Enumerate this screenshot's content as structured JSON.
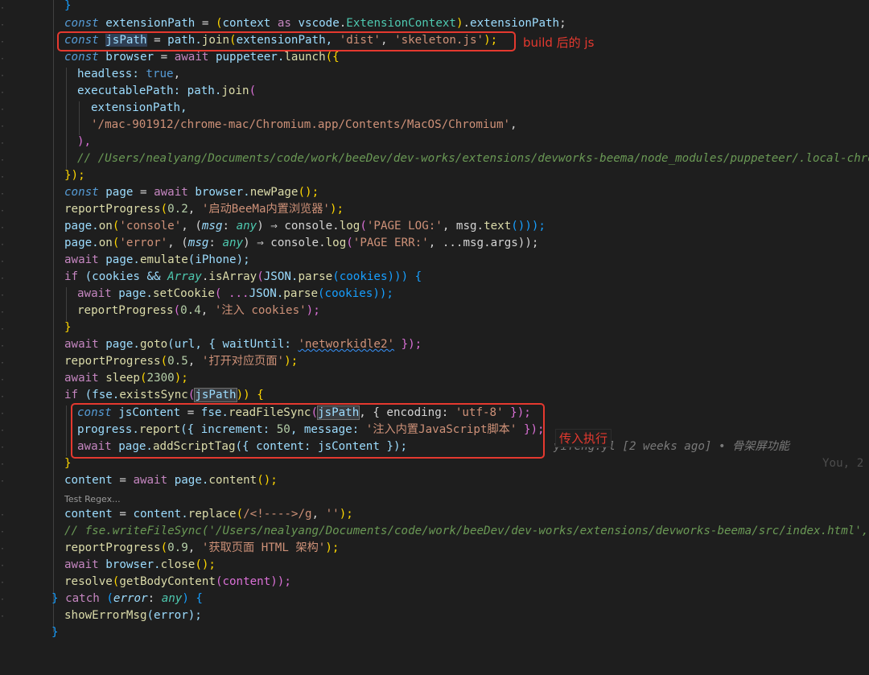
{
  "lines": {
    "close_brace_top": "}",
    "extensionPath_decl": [
      "const",
      "extensionPath",
      "=",
      "(context",
      "as",
      "vscode.ExtensionContext).extensionPath;"
    ],
    "jsPath": {
      "const": "const",
      "name": "jsPath",
      "eq": "=",
      "obj": "path.",
      "fn": "join",
      "open": "(",
      "arg1": "extensionPath, ",
      "s1": "'dist'",
      "comma": ", ",
      "s2": "'skeleton.js'",
      "close": ");"
    },
    "browser": {
      "const": "const",
      "name": "browser",
      "eq": "=",
      "await": "await",
      "obj": "puppeteer.",
      "fn": "launch",
      "open": "({"
    },
    "headless": {
      "key": "headless:",
      "val": "true",
      "comma": ","
    },
    "executablePath": {
      "key": "executablePath:",
      "obj": "path.",
      "fn": "join",
      "open": "("
    },
    "extensionPath_arg": "extensionPath,",
    "chromium_path": "'/mac-901912/chrome-mac/Chromium.app/Contents/MacOS/Chromium'",
    "chromium_comma": ",",
    "close_paren": "),",
    "comment_users": "// /Users/nealyang/Documents/code/work/beeDev/dev-works/extensions/devworks-beema/node_modules/puppeteer/.local-chrom",
    "close_launch": "});",
    "page_decl": {
      "const": "const",
      "name": "page",
      "eq": "=",
      "await": "await",
      "obj": "browser.",
      "fn": "newPage",
      "call": "();"
    },
    "report1": {
      "fn": "reportProgress",
      "open": "(",
      "num": "0.2",
      "comma": ", ",
      "str": "'启动BeeMa内置浏览器'",
      "close": ");"
    },
    "on_console": {
      "obj": "page.",
      "fn": "on",
      "open": "(",
      "str": "'console'",
      "comma": ", (",
      "param": "msg",
      "colon": ":",
      "type": "any",
      "arrow": ") ⇒ console.",
      "fn2": "log",
      "open2": "(",
      "str2": "'PAGE LOG:'",
      "rest": ", msg.",
      "fn3": "text",
      "close": "()));"
    },
    "on_error": {
      "obj": "page.",
      "fn": "on",
      "open": "(",
      "str": "'error'",
      "comma": ", (",
      "param": "msg",
      "colon": ":",
      "type": "any",
      "arrow": ") ⇒ console.",
      "fn2": "log",
      "open2": "(",
      "str2": "'PAGE ERR:'",
      "rest": ", ...msg.args));"
    },
    "emulate": {
      "await": "await",
      "obj": "page.",
      "fn": "emulate",
      "arg": "(iPhone);"
    },
    "if_cookies": {
      "if": "if",
      "open": "(cookies && ",
      "cls": "Array",
      "dot": ".",
      "fn": "isArray",
      "p1": "(",
      "obj": "JSON.",
      "fn2": "parse",
      "p2": "(cookies))) {"
    },
    "setCookie": {
      "await": "await",
      "obj": "page.",
      "fn": "setCookie",
      "rest1": "( ...",
      "obj2": "JSON.",
      "fn2": "parse",
      "rest2": "(cookies));"
    },
    "report2": {
      "fn": "reportProgress",
      "open": "(",
      "num": "0.4",
      "comma": ", ",
      "str": "'注入 cookies'",
      "close": ");"
    },
    "close_if": "}",
    "goto": {
      "await": "await",
      "obj": "page.",
      "fn": "goto",
      "rest": "(url, { waitUntil: ",
      "str": "'networkidle2'",
      "close": " });"
    },
    "report3": {
      "fn": "reportProgress",
      "open": "(",
      "num": "0.5",
      "comma": ", ",
      "str": "'打开对应页面'",
      "close": ");"
    },
    "sleep": {
      "await": "await",
      "fn": "sleep",
      "open": "(",
      "num": "2300",
      "close": ");"
    },
    "if_exists": {
      "if": "if",
      "open": "(fse.",
      "fn": "existsSync",
      "p": "(",
      "name": "jsPath",
      "close": ")) {"
    },
    "jsContent": {
      "const": "const",
      "name": "jsContent",
      "eq": "=",
      "obj": "fse.",
      "fn": "readFileSync",
      "open": "(",
      "arg": "jsPath",
      "rest": ", { encoding: ",
      "str": "'utf-8'",
      "close": " });"
    },
    "progress_report": {
      "obj": "progress.",
      "fn": "report",
      "rest": "({ increment: ",
      "num": "50",
      "rest2": ", message: ",
      "str": "'注入内置JavaScript脚本'",
      "close": " });"
    },
    "addScriptTag": {
      "await": "await",
      "obj": "page.",
      "fn": "addScriptTag",
      "rest": "({ content: jsContent });"
    },
    "close_if2": "}",
    "content_decl": {
      "name": "content",
      "eq": "=",
      "await": "await",
      "obj": "page.",
      "fn": "content",
      "close": "();"
    },
    "test_regex": "Test Regex...",
    "replace": {
      "name": "content",
      "eq": "=",
      "obj": "content.",
      "fn": "replace",
      "open": "(",
      "regex": "/<!---->/g",
      "comma": ", ",
      "str": "''",
      "close": ");"
    },
    "comment_fse": "// fse.writeFileSync('/Users/nealyang/Documents/code/work/beeDev/dev-works/extensions/devworks-beema/src/index.html', c",
    "report4": {
      "fn": "reportProgress",
      "open": "(",
      "num": "0.9",
      "comma": ", ",
      "str": "'获取页面 HTML 架构'",
      "close": ");"
    },
    "close_browser": {
      "await": "await",
      "obj": "browser.",
      "fn": "close",
      "close": "();"
    },
    "resolve": {
      "fn": "resolve",
      "open": "(",
      "fn2": "getBodyContent",
      "rest": "(content));"
    },
    "catch": {
      "close": "} ",
      "catch": "catch",
      "rest": " (",
      "param": "error",
      "colon": ": ",
      "type": "any",
      "end": ") {"
    },
    "showErr": {
      "fn": "showErrorMsg",
      "rest": "(error);"
    },
    "last_brace": "}"
  },
  "annotations": {
    "box1_label": "build 后的 js",
    "box2_label": "传入执行"
  },
  "blame": {
    "text": "yifeng.yl [2 weeks ago] • 骨架屏功能",
    "you": "You, 2"
  },
  "colors": {
    "background": "#1e1e1e",
    "annotation_red": "#e5392f",
    "keyword": "#c586c0",
    "string": "#ce9178",
    "function": "#dcdcaa",
    "variable": "#9cdcfe"
  }
}
